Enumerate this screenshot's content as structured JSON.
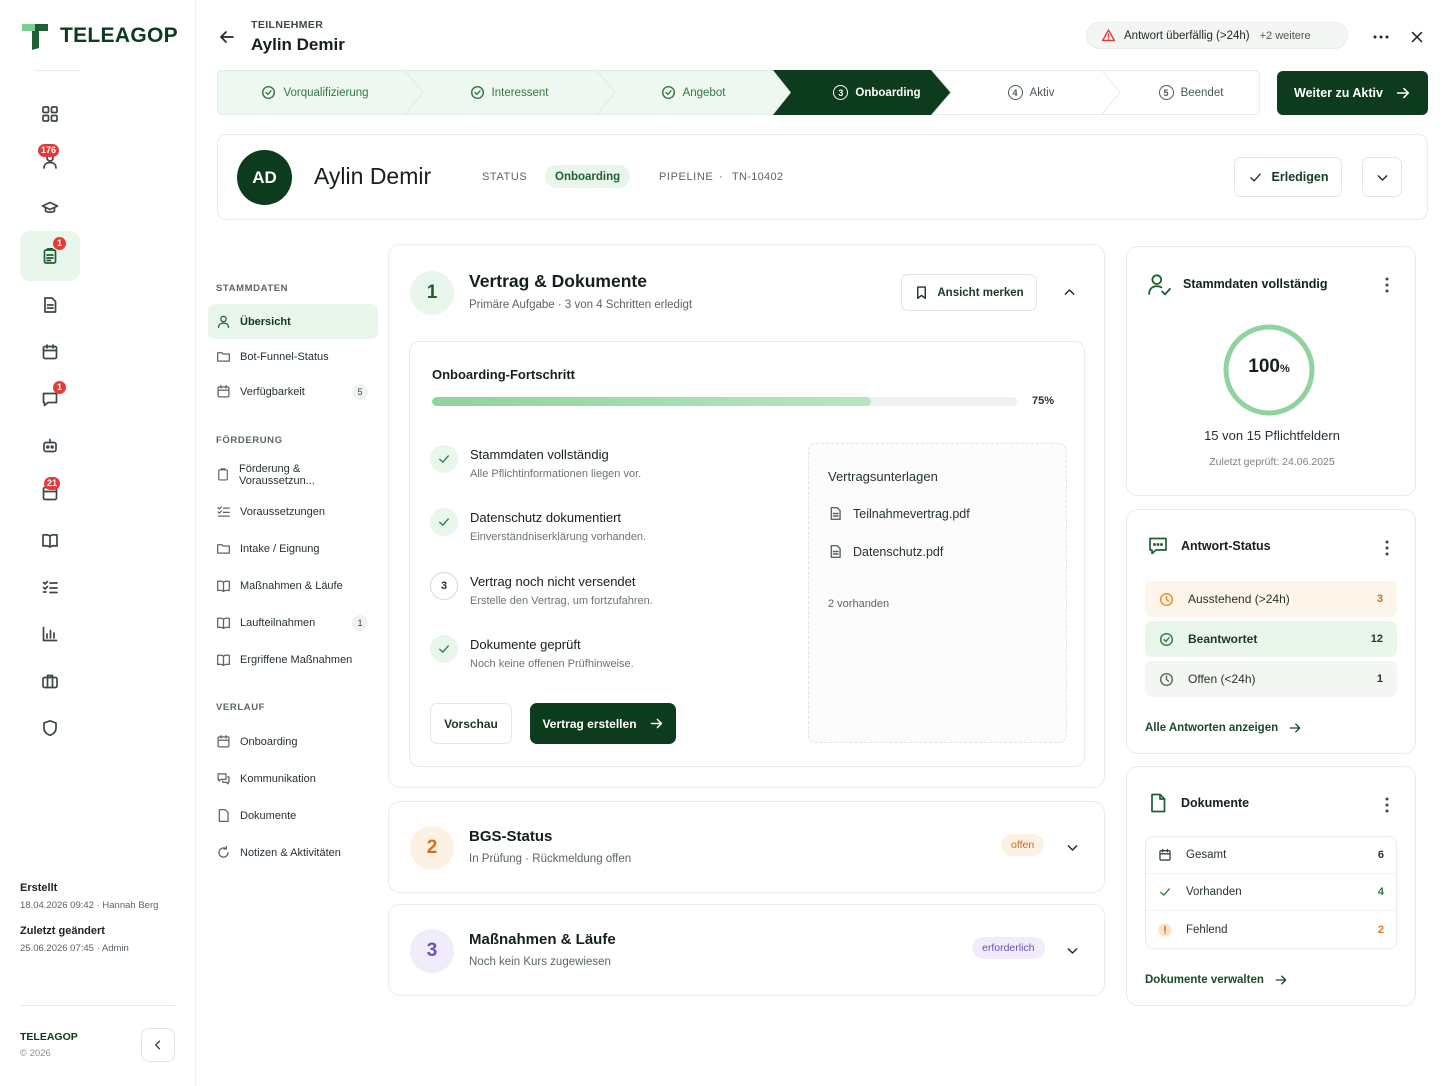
{
  "brand": {
    "name": "TELEAGOP",
    "footer_name": "TELEAGOP",
    "footer_copy": "© 2026"
  },
  "rail": {
    "badges": {
      "people": "176",
      "tasks": "1",
      "messages": "1",
      "calendar": "21"
    }
  },
  "rail_meta": {
    "created_label": "Erstellt",
    "created_value": "18.04.2026 09:42 · Hannah Berg",
    "changed_label": "Zuletzt geändert",
    "changed_value": "25.06.2026 07:45 · Admin"
  },
  "header": {
    "kicker": "TEILNEHMER",
    "name": "Aylin Demir",
    "alert_text": "Antwort überfällig (>24h)",
    "alert_more": "+2 weitere"
  },
  "stepper": {
    "steps": [
      {
        "label": "Vorqualifizierung",
        "state": "done"
      },
      {
        "label": "Interessent",
        "state": "done"
      },
      {
        "label": "Angebot",
        "state": "done"
      },
      {
        "num": "3",
        "label": "Onboarding",
        "state": "current"
      },
      {
        "num": "4",
        "label": "Aktiv",
        "state": "future"
      },
      {
        "num": "5",
        "label": "Beendet",
        "state": "future"
      }
    ],
    "next_label": "Weiter zu Aktiv"
  },
  "profile": {
    "initials": "AD",
    "name": "Aylin Demir",
    "status_label": "STATUS",
    "status_value": "Onboarding",
    "pipeline_label": "PIPELINE",
    "pipeline_value": "TN-10402",
    "done_label": "Erledigen"
  },
  "section_nav": {
    "groups": [
      {
        "title": "STAMMDATEN",
        "items": [
          {
            "label": "Übersicht",
            "icon": "user-icon",
            "active": true
          },
          {
            "label": "Bot-Funnel-Status",
            "icon": "folder-icon"
          },
          {
            "label": "Verfügbarkeit",
            "icon": "calendar-icon",
            "count": "5"
          }
        ]
      },
      {
        "title": "FÖRDERUNG",
        "items": [
          {
            "label": "Förderung & Voraussetzun...",
            "icon": "clipboard-icon"
          },
          {
            "label": "Voraussetzungen",
            "icon": "checklist-icon"
          },
          {
            "label": "Intake / Eignung",
            "icon": "folder-icon"
          },
          {
            "label": "Maßnahmen & Läufe",
            "icon": "book-icon"
          },
          {
            "label": "Laufteilnahmen",
            "icon": "book-icon",
            "count": "1"
          },
          {
            "label": "Ergriffene Maßnahmen",
            "icon": "book-icon"
          }
        ]
      },
      {
        "title": "VERLAUF",
        "items": [
          {
            "label": "Onboarding",
            "icon": "calendar-icon"
          },
          {
            "label": "Kommunikation",
            "icon": "chat-icon"
          },
          {
            "label": "Dokumente",
            "icon": "file-icon"
          },
          {
            "label": "Notizen & Aktivitäten",
            "icon": "refresh-icon"
          }
        ]
      }
    ]
  },
  "task": {
    "number": "1",
    "title": "Vertrag & Dokumente",
    "subtitle": "Primäre Aufgabe · 3 von 4 Schritten erledigt",
    "bookmark_label": "Ansicht merken",
    "progress_label": "Onboarding-Fortschritt",
    "progress_value": 0.75,
    "progress_pct": "75%",
    "checks": [
      {
        "title": "Stammdaten vollständig",
        "sub": "Alle Pflichtinformationen liegen vor.",
        "done": true
      },
      {
        "title": "Datenschutz dokumentiert",
        "sub": "Einverständniserklärung vorhanden.",
        "done": true
      },
      {
        "num": "3",
        "title": "Vertrag noch nicht versendet",
        "sub": "Erstelle den Vertrag, um fortzufahren.",
        "done": false
      },
      {
        "title": "Dokumente geprüft",
        "sub": "Noch keine offenen Prüfhinweise.",
        "done": true
      }
    ],
    "preview_label": "Vorschau",
    "create_label": "Vertrag erstellen",
    "docs": {
      "title": "Vertragsunterlagen",
      "files": [
        "Teilnahmevertrag.pdf",
        "Datenschutz.pdf"
      ],
      "count_text": "2 vorhanden"
    }
  },
  "mini_tasks": [
    {
      "number": "2",
      "title": "BGS-Status",
      "subtitle": "In Prüfung · Rückmeldung offen",
      "badge": "offen"
    },
    {
      "number": "3",
      "title": "Maßnahmen & Läufe",
      "subtitle": "Noch kein Kurs zugewiesen",
      "badge": "erforderlich"
    }
  ],
  "panel_master": {
    "title": "Stammdaten vollständig",
    "percent_value": 100,
    "percent_num": "100",
    "percent_sign": "%",
    "line": "15 von 15 Pflichtfeldern",
    "checked": "Zuletzt geprüft: 24.06.2025"
  },
  "panel_answers": {
    "title": "Antwort-Status",
    "rows": [
      {
        "label": "Ausstehend (>24h)",
        "count": "3"
      },
      {
        "label": "Beantwortet",
        "count": "12"
      },
      {
        "label": "Offen (<24h)",
        "count": "1"
      }
    ],
    "link": "Alle Antworten anzeigen"
  },
  "panel_docs": {
    "title": "Dokumente",
    "rows": [
      {
        "label": "Gesamt",
        "count": "6"
      },
      {
        "label": "Vorhanden",
        "count": "4"
      },
      {
        "label": "Fehlend",
        "count": "2"
      }
    ],
    "link": "Dokumente verwalten"
  },
  "colors": {
    "brand_dark": "#0c3b1e",
    "accent_green": "#2f7a44",
    "accent_light": "#e9f6ec",
    "warn_orange": "#f08a24",
    "alert_red": "#e63a3a",
    "purple": "#6b4fb8"
  }
}
